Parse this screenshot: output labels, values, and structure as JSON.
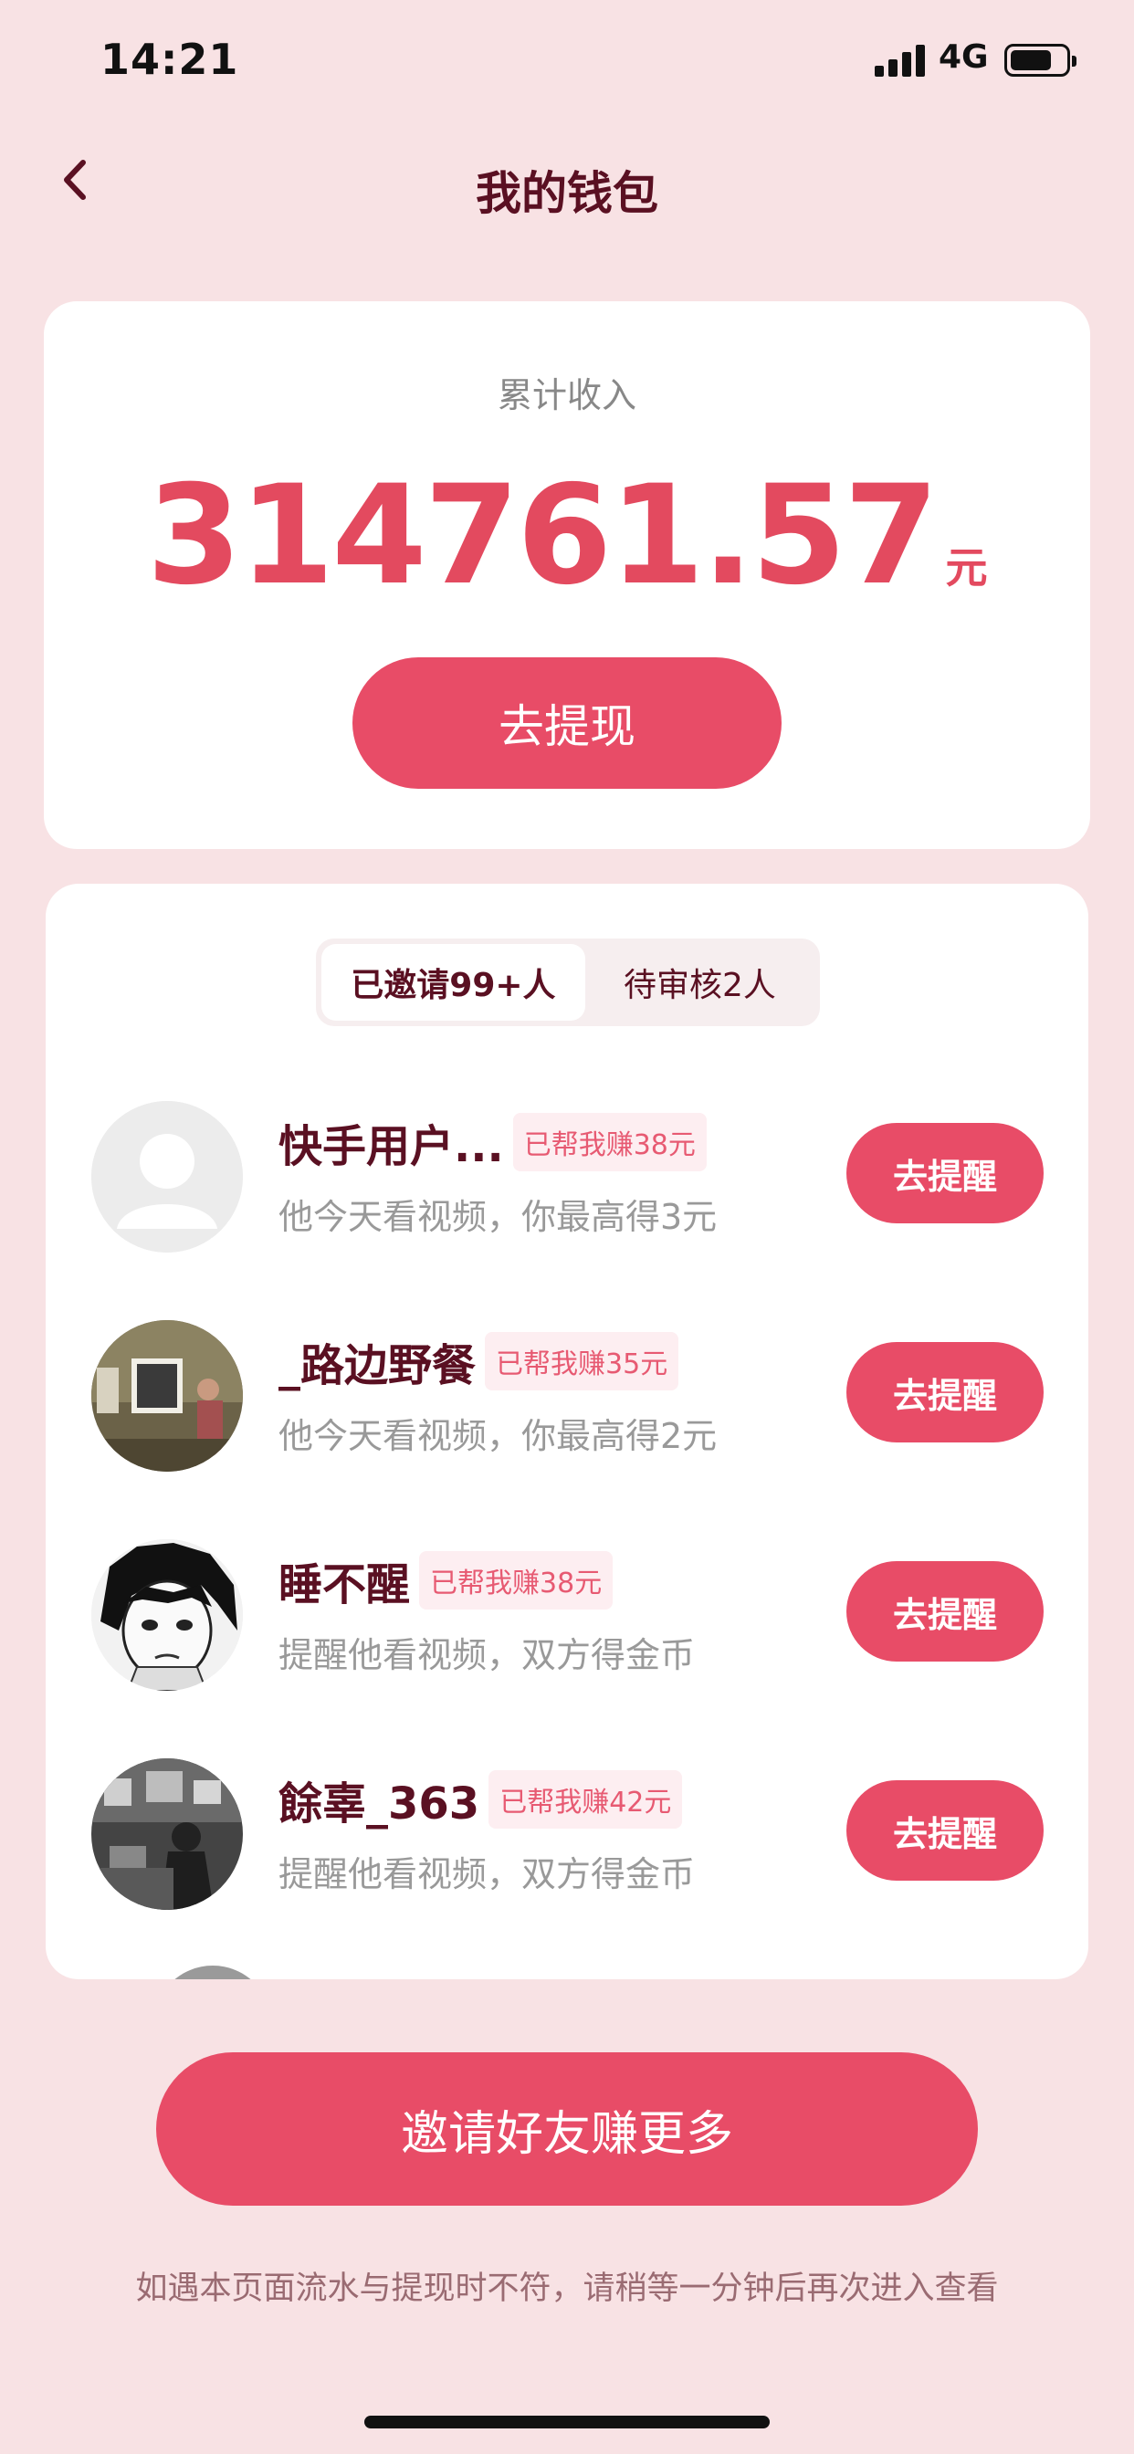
{
  "status_bar": {
    "time": "14:21",
    "network": "4G"
  },
  "nav": {
    "title": "我的钱包"
  },
  "income": {
    "label": "累计收入",
    "amount": "314761.57",
    "unit": "元",
    "withdraw_label": "去提现"
  },
  "tabs": [
    {
      "label": "已邀请99+人",
      "active": true
    },
    {
      "label": "待审核2人",
      "active": false
    }
  ],
  "friends": [
    {
      "name": "快手用户...",
      "badge": "已帮我赚38元",
      "desc": "他今天看视频，你最高得3元",
      "button": "去提醒",
      "avatar": "default-avatar"
    },
    {
      "name": "_路边野餐",
      "badge": "已帮我赚35元",
      "desc": "他今天看视频，你最高得2元",
      "button": "去提醒",
      "avatar": "photo-avatar"
    },
    {
      "name": "睡不醒",
      "badge": "已帮我赚38元",
      "desc": "提醒他看视频，双方得金币",
      "button": "去提醒",
      "avatar": "anime-avatar"
    },
    {
      "name": "餘辜_363",
      "badge": "已帮我赚42元",
      "desc": "提醒他看视频，双方得金币",
      "button": "去提醒",
      "avatar": "photo-avatar-bw"
    }
  ],
  "invite_button": "邀请好友赚更多",
  "footer_note": "如遇本页面流水与提现时不符，请稍等一分钟后再次进入查看",
  "colors": {
    "accent": "#e84c67",
    "amount": "#e34a5f",
    "background": "#f8e2e4",
    "title": "#5a1022"
  }
}
